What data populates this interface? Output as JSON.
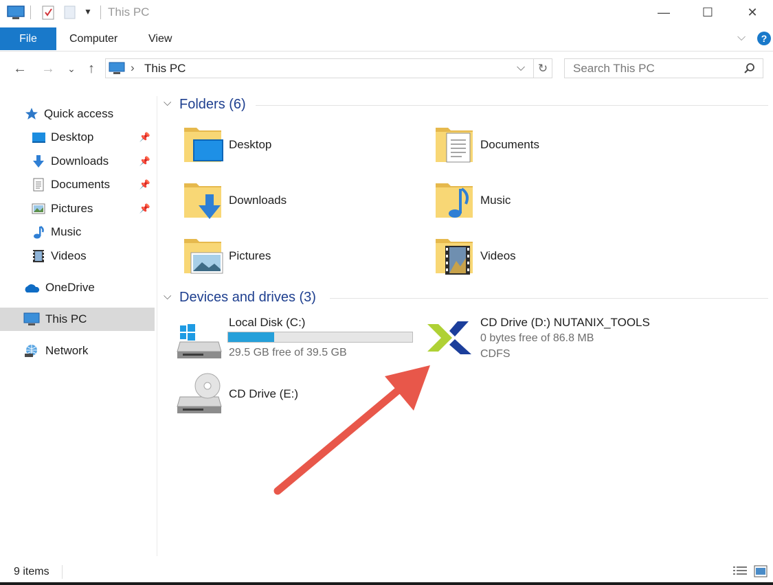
{
  "window": {
    "title": "This PC",
    "minimize_glyph": "—",
    "maximize_glyph": "☐",
    "close_glyph": "✕"
  },
  "ribbon": {
    "tabs": [
      {
        "label": "File",
        "active": true
      },
      {
        "label": "Computer",
        "active": false
      },
      {
        "label": "View",
        "active": false
      }
    ],
    "expand_glyph": "⌵",
    "help_glyph": "?"
  },
  "nav": {
    "back_glyph": "←",
    "forward_glyph": "→",
    "recent_glyph": "⌄",
    "up_glyph": "↑"
  },
  "address": {
    "separator": "›",
    "path": "This PC",
    "dropdown_glyph": "⌵",
    "refresh_glyph": "↻"
  },
  "search": {
    "placeholder": "Search This PC"
  },
  "sidebar": {
    "items": [
      {
        "label": "Quick access",
        "icon": "star-icon"
      },
      {
        "label": "Desktop",
        "icon": "desktop-icon",
        "pinned": true
      },
      {
        "label": "Downloads",
        "icon": "download-icon",
        "pinned": true
      },
      {
        "label": "Documents",
        "icon": "documents-icon",
        "pinned": true
      },
      {
        "label": "Pictures",
        "icon": "pictures-icon",
        "pinned": true
      },
      {
        "label": "Music",
        "icon": "music-icon"
      },
      {
        "label": "Videos",
        "icon": "videos-icon"
      },
      {
        "label": "OneDrive",
        "icon": "cloud-icon"
      },
      {
        "label": "This PC",
        "icon": "computer-icon",
        "selected": true
      },
      {
        "label": "Network",
        "icon": "network-icon"
      }
    ],
    "pin_glyph": "📌"
  },
  "folders": {
    "header": "Folders (6)",
    "items": [
      {
        "label": "Desktop"
      },
      {
        "label": "Documents"
      },
      {
        "label": "Downloads"
      },
      {
        "label": "Music"
      },
      {
        "label": "Pictures"
      },
      {
        "label": "Videos"
      }
    ]
  },
  "drives": {
    "header": "Devices and drives (3)",
    "items": [
      {
        "name": "Local Disk (C:)",
        "free": "29.5 GB free of 39.5 GB",
        "used_fraction": 0.25
      },
      {
        "name": "CD Drive (D:) NUTANIX_TOOLS",
        "free": "0 bytes free of 86.8 MB",
        "fs": "CDFS"
      },
      {
        "name": "CD Drive (E:)"
      }
    ]
  },
  "status": {
    "count": "9 items"
  },
  "colors": {
    "accent": "#1979ca",
    "folder_yellow": "#f8d775",
    "arrow_red": "#e8574a",
    "nutanix_green": "#afd135",
    "nutanix_blue": "#1b3e9b"
  }
}
